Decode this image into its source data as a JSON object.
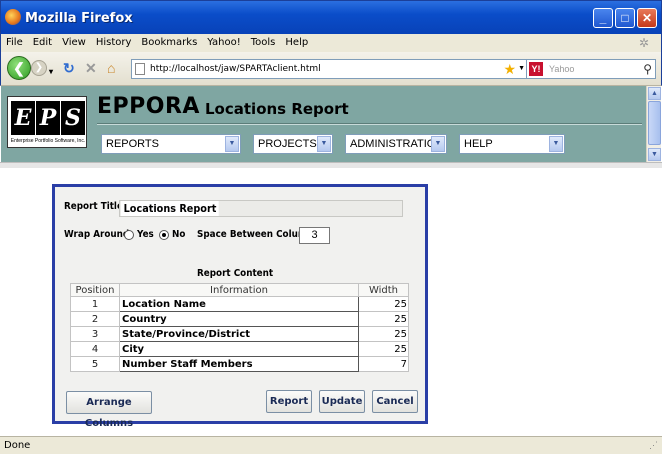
{
  "window": {
    "title": "Mozilla Firefox"
  },
  "menubar": {
    "items": [
      "File",
      "Edit",
      "View",
      "History",
      "Bookmarks",
      "Yahoo!",
      "Tools",
      "Help"
    ]
  },
  "navbar": {
    "url": "http://localhost/jaw/SPARTAclient.html",
    "search_placeholder": "Yahoo"
  },
  "app": {
    "logo_letters": [
      "E",
      "P",
      "S"
    ],
    "logo_subtitle": "Enterprise Portfolio Software, Inc.",
    "brand": "EPPORA",
    "page_title": "Locations Report",
    "nav": [
      "REPORTS",
      "PROJECTS",
      "ADMINISTRATION",
      "HELP"
    ]
  },
  "dialog": {
    "report_title_label": "Report Title:",
    "report_title_value": "Locations Report",
    "wrap_label": "Wrap Around:",
    "wrap_yes": "Yes",
    "wrap_no": "No",
    "wrap_selected": "No",
    "space_label": "Space Between Columns:",
    "space_value": "3",
    "content_label": "Report Content",
    "table": {
      "headers": [
        "Position",
        "Information",
        "Width"
      ],
      "rows": [
        {
          "position": "1",
          "info": "Location Name",
          "width": "25"
        },
        {
          "position": "2",
          "info": "Country",
          "width": "25"
        },
        {
          "position": "3",
          "info": "State/Province/District",
          "width": "25"
        },
        {
          "position": "4",
          "info": "City",
          "width": "25"
        },
        {
          "position": "5",
          "info": "Number Staff Members",
          "width": "7"
        }
      ]
    },
    "buttons": {
      "arrange": "Arrange Columns",
      "report": "Report",
      "update": "Update",
      "cancel": "Cancel"
    }
  },
  "status": {
    "text": "Done"
  },
  "colors": {
    "header_bg": "#7fa6a2",
    "dialog_border": "#2a3ea6",
    "titlebar": "#0a4dc9"
  }
}
